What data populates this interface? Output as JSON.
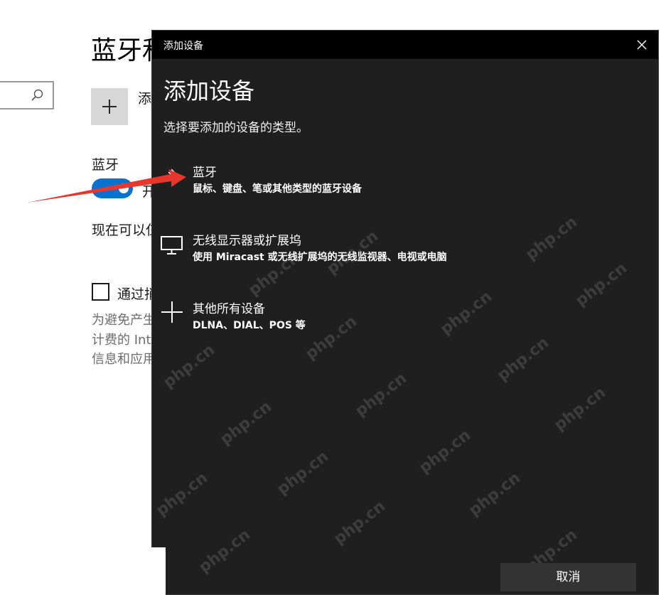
{
  "background_page": {
    "title": "蓝牙和",
    "add_device_label": "添",
    "bluetooth_label": "蓝牙",
    "toggle_label": "开",
    "discoverable_text": "现在可以仨",
    "checkbox_label": "通过捎",
    "description_lines": [
      "为避免产生",
      "计费的 Int",
      "信息和应用"
    ],
    "toggle_color": "#0a72cc"
  },
  "dialog": {
    "titlebar": "添加设备",
    "heading": "添加设备",
    "subtitle": "选择要添加的设备的类型。",
    "options": [
      {
        "icon": "bluetooth-icon",
        "title": "蓝牙",
        "description": "鼠标、键盘、笔或其他类型的蓝牙设备"
      },
      {
        "icon": "monitor-icon",
        "title": "无线显示器或扩展坞",
        "description": "使用 Miracast 或无线扩展坞的无线监视器、电视或电脑"
      },
      {
        "icon": "plus-icon",
        "title": "其他所有设备",
        "description": "DLNA、DIAL、POS 等"
      }
    ],
    "cancel_label": "取消",
    "background_color": "#1f1f1f"
  },
  "watermark_text": "php.cn",
  "annotation_color": "#e8362c"
}
